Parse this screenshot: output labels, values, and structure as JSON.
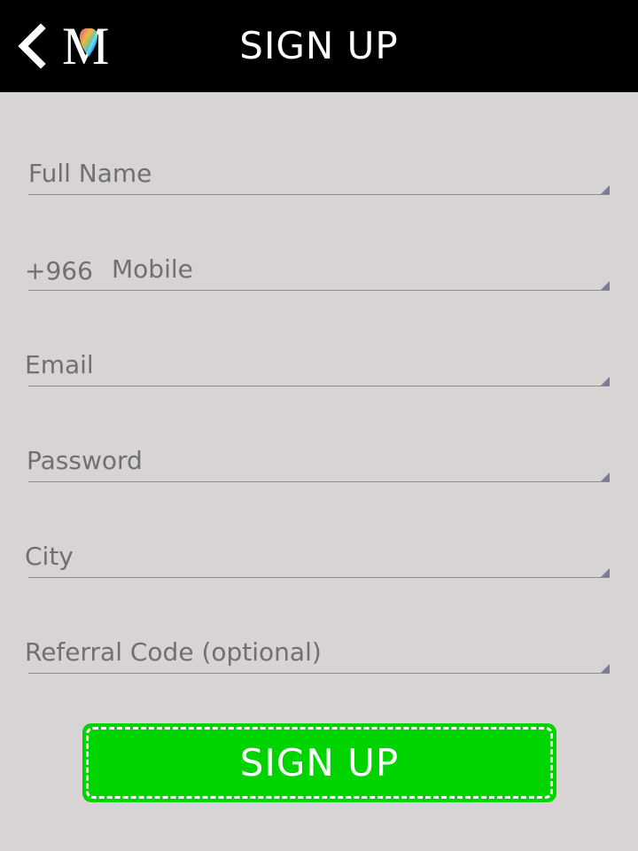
{
  "header": {
    "title": "SIGN UP",
    "back_icon": "chevron-left-icon",
    "logo_letter": "M"
  },
  "form": {
    "full_name_placeholder": "Full Name",
    "mobile_prefix": "+966",
    "mobile_placeholder": "Mobile",
    "email_placeholder": "Email",
    "password_placeholder": "Password",
    "city_placeholder": "City",
    "referral_placeholder": "Referral Code (optional)"
  },
  "submit": {
    "label": "SIGN UP"
  },
  "colors": {
    "header_bg": "#000000",
    "page_bg": "#d7d4d3",
    "button_bg": "#00d400",
    "field_line": "#8a8a9e"
  }
}
